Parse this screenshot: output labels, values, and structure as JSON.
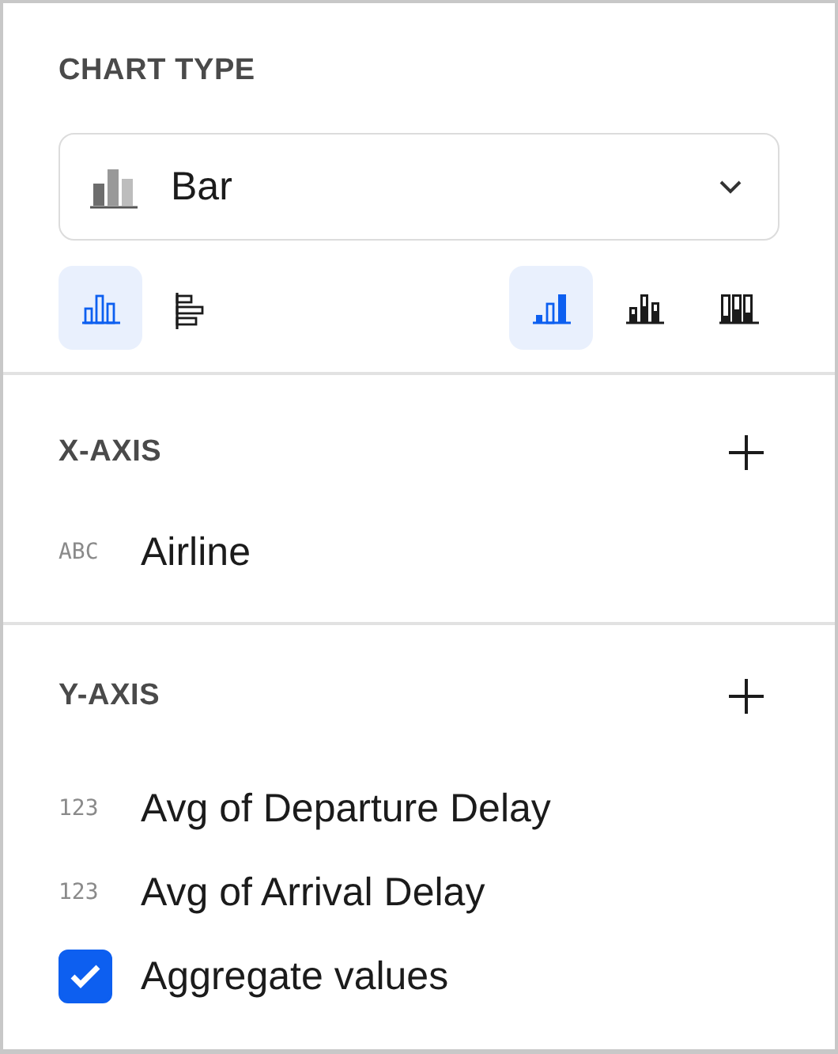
{
  "chart_type": {
    "heading": "CHART TYPE",
    "dropdown": {
      "value": "Bar"
    },
    "orientation": [
      {
        "kind": "vertical",
        "selected": true
      },
      {
        "kind": "horizontal",
        "selected": false
      }
    ],
    "layout": [
      {
        "kind": "grouped",
        "selected": true
      },
      {
        "kind": "stacked",
        "selected": false
      },
      {
        "kind": "full",
        "selected": false
      }
    ]
  },
  "x_axis": {
    "heading": "X-AXIS",
    "fields": [
      {
        "type_label": "ABC",
        "name": "Airline"
      }
    ]
  },
  "y_axis": {
    "heading": "Y-AXIS",
    "fields": [
      {
        "type_label": "123",
        "name": "Avg of Departure Delay"
      },
      {
        "type_label": "123",
        "name": "Avg of Arrival Delay"
      }
    ],
    "aggregate": {
      "label": "Aggregate values",
      "checked": true
    }
  }
}
